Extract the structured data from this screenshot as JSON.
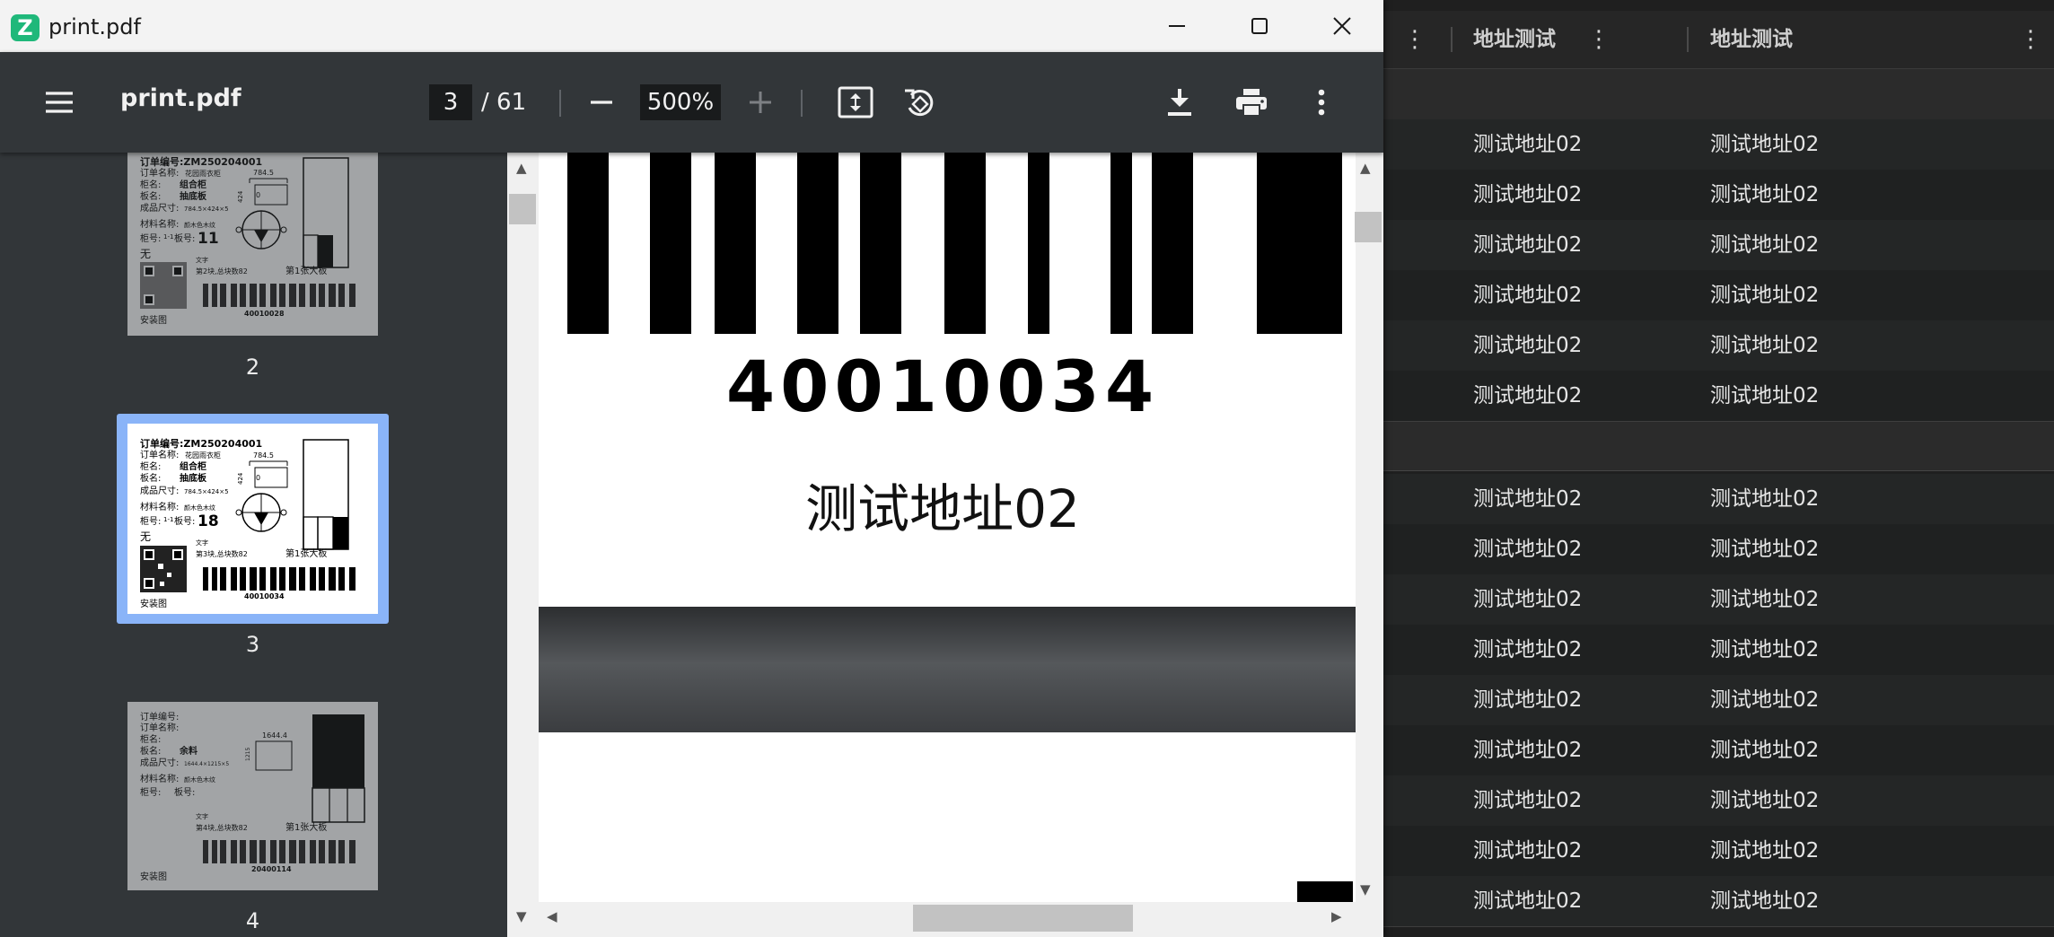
{
  "window": {
    "title": "print.pdf",
    "app_icon_letter": "Z"
  },
  "toolbar": {
    "doc_title": "print.pdf",
    "current_page": "3",
    "page_total": "/ 61",
    "zoom": "500%"
  },
  "thumbnails": [
    {
      "page": "2",
      "order_no": "订单编号:ZM250204001",
      "order_name": "订单名称:",
      "order_name_val": "花园雨衣柜",
      "cabinet": "柜名:",
      "cabinet_val": "组合柜",
      "board": "板名:",
      "board_val": "抽底板",
      "size": "成品尺寸:",
      "size_val": "784.5×424×5",
      "material": "材料名称:",
      "material_val": "颜木色木纹",
      "cab_no": "柜号:",
      "cab_no_val": "1-1",
      "board_no": "板号:",
      "board_no_val": "11",
      "none": "无",
      "text_label": "文字",
      "block_info": "第2块,总块数82",
      "big_board": "第1张大板",
      "install": "安装图",
      "barcode": "40010028",
      "dim_w": "784.5",
      "dim_h": "424",
      "zero": "0"
    },
    {
      "page": "3",
      "order_no": "订单编号:ZM250204001",
      "order_name": "订单名称:",
      "order_name_val": "花园雨衣柜",
      "cabinet": "柜名:",
      "cabinet_val": "组合柜",
      "board": "板名:",
      "board_val": "抽底板",
      "size": "成品尺寸:",
      "size_val": "784.5×424×5",
      "material": "材料名称:",
      "material_val": "颜木色木纹",
      "cab_no": "柜号:",
      "cab_no_val": "1-1",
      "board_no": "板号:",
      "board_no_val": "18",
      "none": "无",
      "text_label": "文字",
      "block_info": "第3块,总块数82",
      "big_board": "第1张大板",
      "install": "安装图",
      "barcode": "40010034",
      "dim_w": "784.5",
      "dim_h": "424",
      "zero": "0"
    },
    {
      "page": "4",
      "order_no": "订单编号:",
      "order_name": "订单名称:",
      "cabinet": "柜名:",
      "board": "板名:",
      "board_val": "余料",
      "size": "成品尺寸:",
      "size_val": "1644.4×1215×5",
      "material": "材料名称:",
      "material_val": "颜木色木纹",
      "cab_no": "柜号:",
      "board_no": "板号:",
      "text_label": "文字",
      "block_info": "第4块,总块数82",
      "big_board": "第1张大板",
      "install": "安装图",
      "barcode": "20400114",
      "dim_w": "1644.4",
      "dim_h": "1215"
    }
  ],
  "page_view": {
    "barcode_number": "40010034",
    "address": "测试地址02"
  },
  "table": {
    "columns": [
      "地址测试",
      "地址测试"
    ],
    "rows": [
      [
        "测试地址02",
        "测试地址02"
      ],
      [
        "测试地址02",
        "测试地址02"
      ],
      [
        "测试地址02",
        "测试地址02"
      ],
      [
        "测试地址02",
        "测试地址02"
      ],
      [
        "测试地址02",
        "测试地址02"
      ],
      [
        "测试地址02",
        "测试地址02"
      ],
      [
        "测试地址02",
        "测试地址02"
      ],
      [
        "测试地址02",
        "测试地址02"
      ],
      [
        "测试地址02",
        "测试地址02"
      ],
      [
        "测试地址02",
        "测试地址02"
      ],
      [
        "测试地址02",
        "测试地址02"
      ],
      [
        "测试地址02",
        "测试地址02"
      ],
      [
        "测试地址02",
        "测试地址02"
      ],
      [
        "测试地址02",
        "测试地址02"
      ],
      [
        "测试地址02",
        "测试地址02"
      ]
    ]
  }
}
